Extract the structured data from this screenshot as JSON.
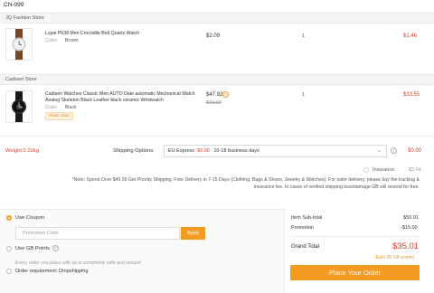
{
  "order_id": "CN-099",
  "stores": [
    {
      "name": "JQ Fashion Store",
      "product": {
        "name": "Lvpai P638 Men Crocodile Belt Quartz Watch",
        "attr_label": "Color:",
        "attr_value": "Brown",
        "price": "$2.09",
        "quantity": "1",
        "total": "$1.46"
      }
    },
    {
      "name": "Cadisen Store",
      "product": {
        "name": "Cadisen Watches Classic Men AUTO Date automatic Mechanical Watch Analog Skeleton Black Leather black ceramic Wristwatch",
        "attr_label": "Color:",
        "attr_value": "Black",
        "badge": "Flash Sale",
        "price": "$47.92",
        "old_price": "$79.63",
        "quantity": "1",
        "total": "$33.55"
      }
    }
  ],
  "shipping": {
    "weight": "Weight:0.22kg",
    "label": "Shipping Options:",
    "method": "EU Express",
    "fee": "$0.00",
    "days": "10-18 business days",
    "cost": "$0.00",
    "insurance_label": "Insurance",
    "insurance_cost": "$3.64",
    "note": "*Note: Spend Over $49.99 Get Priority Shipping. Free Delivery in 7-15 Days (Clothing, Bags & Shoes, Jewelry & Watches). For safer delivery, please buy the tracking & insurance fee. In cases of verified shipping loss/damage GB will resend for free."
  },
  "payment_options": {
    "use_coupon": "Use Coupon",
    "promo_placeholder": "Promotion Code",
    "apply": "Apply",
    "use_gb_points": "Use GB Points",
    "safe_text": "Every order you place with us is completely safe and secure!",
    "requirement": "Order requirement: Dropshipping"
  },
  "summary": {
    "subtotal_label": "Item Sub-total",
    "subtotal_value": "$50.01",
    "promotion_label": "Promotion",
    "promotion_value": "-$15.00",
    "grand_label": "Grand Total",
    "grand_value": "$35.01",
    "earn_text": "(Earn 35 GB points)",
    "place_order": "Place Your Order"
  },
  "colors": {
    "accent": "#f39a20",
    "price_red": "#e13b2a"
  }
}
